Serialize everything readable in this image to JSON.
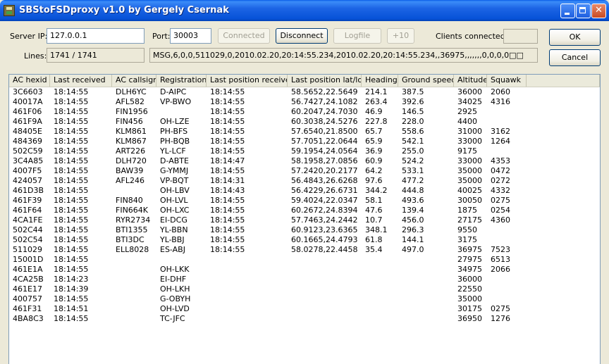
{
  "window": {
    "title": "SBStoFSDproxy v1.0 by Gergely Csernak"
  },
  "server": {
    "label": "Server IP:",
    "value": "127.0.0.1"
  },
  "port": {
    "label": "Port:",
    "value": "30003"
  },
  "buttons": {
    "connected": "Connected",
    "disconnect": "Disconnect",
    "logfile": "Logfile",
    "plus10": "+10",
    "ok": "OK",
    "cancel": "Cancel"
  },
  "clients": {
    "label": "Clients connected:",
    "value": ""
  },
  "lines": {
    "label": "Lines:",
    "value": "1741 / 1741"
  },
  "last_message": "MSG,6,0,0,511029,0,2010.02.20,20:14:55.234,2010.02.20,20:14:55.234,,36975,,,,,,,0,0,0,0□□",
  "table": {
    "columns": [
      "AC hexid",
      "Last received",
      "AC callsign",
      "Registration",
      "Last position received",
      "Last position lat/lon",
      "Heading",
      "Ground speed",
      "Altitude",
      "Squawk",
      ""
    ],
    "rows": [
      [
        "3C6603",
        "18:14:55",
        "DLH6YC",
        "D-AIPC",
        "18:14:55",
        "58.5652,22.5649",
        "214.1",
        "387.5",
        "36000",
        "2060"
      ],
      [
        "40017A",
        "18:14:55",
        "AFL582",
        "VP-BWO",
        "18:14:55",
        "56.7427,24.1082",
        "263.4",
        "392.6",
        "34025",
        "4316"
      ],
      [
        "461F06",
        "18:14:55",
        "FIN1956",
        "",
        "18:14:55",
        "60.2047,24.7030",
        "46.9",
        "146.5",
        "2925",
        ""
      ],
      [
        "461F9A",
        "18:14:55",
        "FIN456",
        "OH-LZE",
        "18:14:55",
        "60.3038,24.5276",
        "227.8",
        "228.0",
        "4400",
        ""
      ],
      [
        "48405E",
        "18:14:55",
        "KLM861",
        "PH-BFS",
        "18:14:55",
        "57.6540,21.8500",
        "65.7",
        "558.6",
        "31000",
        "3162"
      ],
      [
        "484369",
        "18:14:55",
        "KLM867",
        "PH-BQB",
        "18:14:55",
        "57.7051,22.0644",
        "65.9",
        "542.1",
        "33000",
        "1264"
      ],
      [
        "502C59",
        "18:14:55",
        "ART226",
        "YL-LCF",
        "18:14:55",
        "59.1954,24.0564",
        "36.9",
        "255.0",
        "9175",
        ""
      ],
      [
        "3C4A85",
        "18:14:55",
        "DLH720",
        "D-ABTE",
        "18:14:47",
        "58.1958,27.0856",
        "60.9",
        "524.2",
        "33000",
        "4353"
      ],
      [
        "4007F5",
        "18:14:55",
        "BAW39",
        "G-YMMJ",
        "18:14:55",
        "57.2420,20.2177",
        "64.2",
        "533.1",
        "35000",
        "0472"
      ],
      [
        "424057",
        "18:14:55",
        "AFL246",
        "VP-BQT",
        "18:14:31",
        "56.4843,26.6268",
        "97.6",
        "477.2",
        "35000",
        "0272"
      ],
      [
        "461D3B",
        "18:14:55",
        "",
        "OH-LBV",
        "18:14:43",
        "56.4229,26.6731",
        "344.2",
        "444.8",
        "40025",
        "4332"
      ],
      [
        "461F39",
        "18:14:55",
        "FIN840",
        "OH-LVL",
        "18:14:55",
        "59.4024,22.0347",
        "58.1",
        "493.6",
        "30050",
        "0275"
      ],
      [
        "461F64",
        "18:14:55",
        "FIN664K",
        "OH-LXC",
        "18:14:55",
        "60.2672,24.8394",
        "47.6",
        "139.4",
        "1875",
        "0254"
      ],
      [
        "4CA1FE",
        "18:14:55",
        "RYR2734",
        "EI-DCG",
        "18:14:55",
        "57.7463,24.2442",
        "10.7",
        "456.0",
        "27175",
        "4360"
      ],
      [
        "502C44",
        "18:14:55",
        "BTI1355",
        "YL-BBN",
        "18:14:55",
        "60.9123,23.6365",
        "348.1",
        "296.3",
        "9550",
        ""
      ],
      [
        "502C54",
        "18:14:55",
        "BTI3DC",
        "YL-BBJ",
        "18:14:55",
        "60.1665,24.4793",
        "61.8",
        "144.1",
        "3175",
        ""
      ],
      [
        "511029",
        "18:14:55",
        "ELL8028",
        "ES-ABJ",
        "18:14:55",
        "58.0278,22.4458",
        "35.4",
        "497.0",
        "36975",
        "7523"
      ],
      [
        "15001D",
        "18:14:55",
        "",
        "",
        "",
        "",
        "",
        "",
        "27975",
        "6513"
      ],
      [
        "461E1A",
        "18:14:55",
        "",
        "OH-LKK",
        "",
        "",
        "",
        "",
        "34975",
        "2066"
      ],
      [
        "4CA25B",
        "18:14:23",
        "",
        "EI-DHF",
        "",
        "",
        "",
        "",
        "36000",
        ""
      ],
      [
        "461E17",
        "18:14:39",
        "",
        "OH-LKH",
        "",
        "",
        "",
        "",
        "22550",
        ""
      ],
      [
        "400757",
        "18:14:55",
        "",
        "G-OBYH",
        "",
        "",
        "",
        "",
        "35000",
        ""
      ],
      [
        "461F31",
        "18:14:51",
        "",
        "OH-LVD",
        "",
        "",
        "",
        "",
        "30175",
        "0275"
      ],
      [
        "4BA8C3",
        "18:14:55",
        "",
        "TC-JFC",
        "",
        "",
        "",
        "",
        "36950",
        "1276"
      ]
    ]
  }
}
